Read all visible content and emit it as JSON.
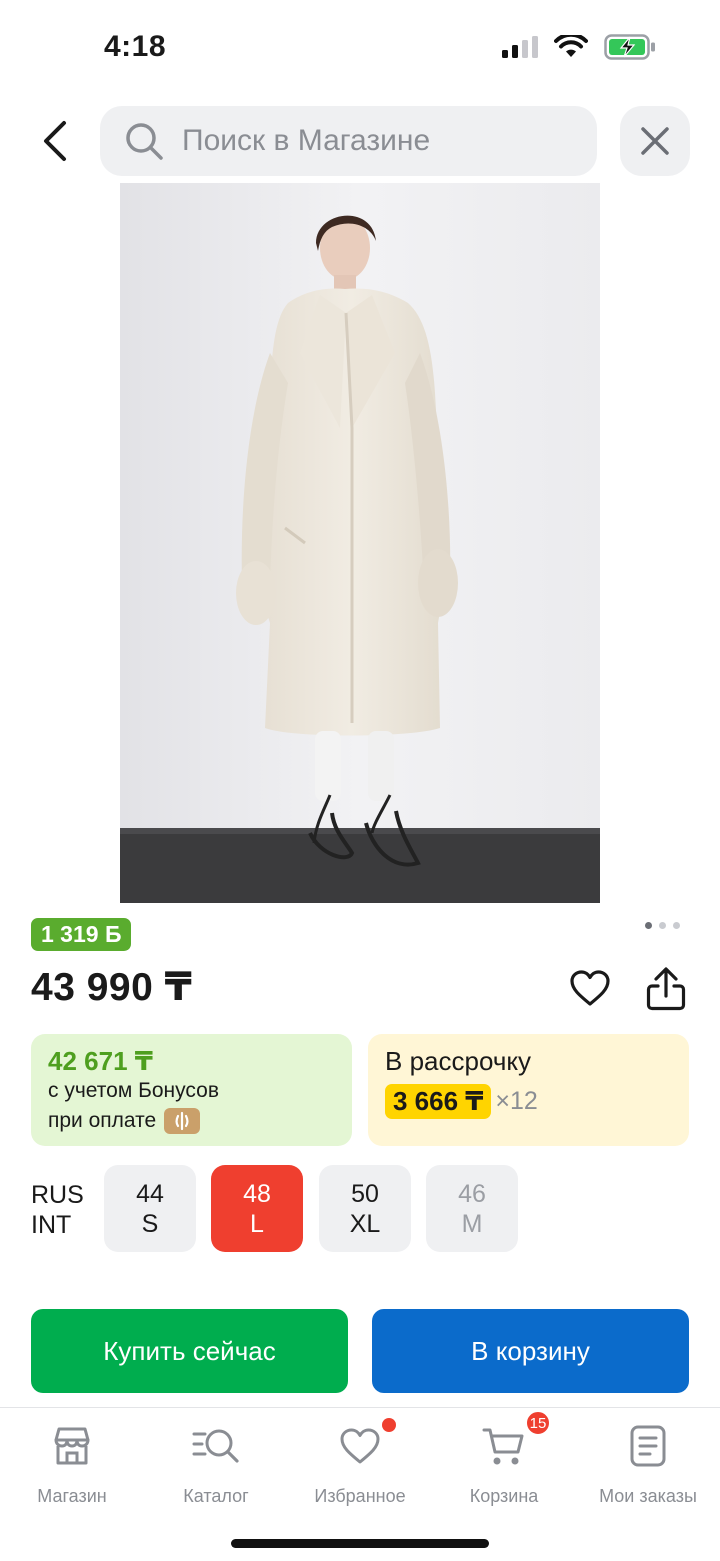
{
  "status_bar": {
    "time": "4:18"
  },
  "search": {
    "placeholder": "Поиск в Магазине"
  },
  "product": {
    "bonus_badge": "1 319 Б",
    "price": "43 990 ₸",
    "image_pager": {
      "count": 3,
      "active_index": 0
    }
  },
  "bonus_card": {
    "amount": "42 671 ₸",
    "line1": "с учетом Бонусов",
    "line2": "при оплате"
  },
  "installment_card": {
    "title": "В рассрочку",
    "monthly": "3 666 ₸",
    "multiplier": "×12"
  },
  "sizes": {
    "label_rus": "RUS",
    "label_int": "INT",
    "options": [
      {
        "rus": "44",
        "int": "S",
        "state": "normal"
      },
      {
        "rus": "48",
        "int": "L",
        "state": "selected"
      },
      {
        "rus": "50",
        "int": "XL",
        "state": "normal"
      },
      {
        "rus": "46",
        "int": "M",
        "state": "disabled"
      }
    ]
  },
  "actions": {
    "buy_now": "Купить сейчас",
    "add_to_cart": "В корзину"
  },
  "tabbar": {
    "items": [
      {
        "label": "Магазин",
        "icon": "store-icon"
      },
      {
        "label": "Каталог",
        "icon": "catalog-search-icon"
      },
      {
        "label": "Избранное",
        "icon": "heart-icon"
      },
      {
        "label": "Корзина",
        "icon": "cart-icon"
      },
      {
        "label": "Мои заказы",
        "icon": "orders-icon"
      }
    ],
    "cart_count": "15"
  },
  "colors": {
    "accent_green": "#00ad4e",
    "accent_blue": "#0b6bcb",
    "selected_red": "#ef3f2f",
    "bonus_green": "#5aac2e",
    "installment_yellow": "#ffd400"
  }
}
